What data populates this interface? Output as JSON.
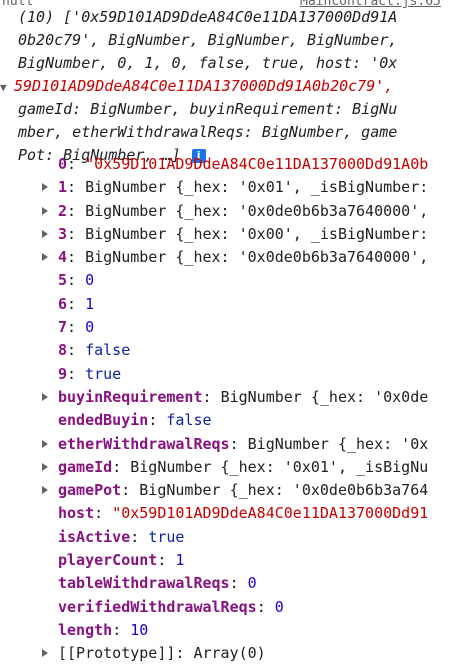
{
  "top_cut": {
    "left_text": "null",
    "right_link": "Maincontract.js:65"
  },
  "summary": {
    "line1": "(10) ['0x59D101AD9DdeA84C0e11DA137000Dd91A",
    "line2": "0b20c79', BigNumber, BigNumber, BigNumber, ",
    "line3": "BigNumber, 0, 1, 0, false, true, host: '0x",
    "line4": "59D101AD9DdeA84C0e11DA137000Dd91A0b20c79',",
    "line5": "gameId: BigNumber, buyinRequirement: BigNu",
    "line6": "mber, etherWithdrawalReqs: BigNumber, game",
    "line7": "Pot: BigNumber, …]",
    "info_icon": "i"
  },
  "entries": [
    {
      "key": "0",
      "type": "str",
      "value": "\"0x59D101AD9DdeA84C0e11DA137000Dd91A0b",
      "expandable": false
    },
    {
      "key": "1",
      "type": "obj",
      "value": "BigNumber {_hex: '0x01', _isBigNumber:",
      "expandable": true
    },
    {
      "key": "2",
      "type": "obj",
      "value": "BigNumber {_hex: '0x0de0b6b3a7640000',",
      "expandable": true
    },
    {
      "key": "3",
      "type": "obj",
      "value": "BigNumber {_hex: '0x00', _isBigNumber:",
      "expandable": true
    },
    {
      "key": "4",
      "type": "obj",
      "value": "BigNumber {_hex: '0x0de0b6b3a7640000',",
      "expandable": true
    },
    {
      "key": "5",
      "type": "num",
      "value": "0",
      "expandable": false
    },
    {
      "key": "6",
      "type": "num",
      "value": "1",
      "expandable": false
    },
    {
      "key": "7",
      "type": "num",
      "value": "0",
      "expandable": false
    },
    {
      "key": "8",
      "type": "kw",
      "value": "false",
      "expandable": false
    },
    {
      "key": "9",
      "type": "kw",
      "value": "true",
      "expandable": false
    },
    {
      "key": "buyinRequirement",
      "type": "obj",
      "value": "BigNumber {_hex: '0x0de",
      "expandable": true
    },
    {
      "key": "endedBuyin",
      "type": "kw",
      "value": "false",
      "expandable": false
    },
    {
      "key": "etherWithdrawalReqs",
      "type": "obj",
      "value": "BigNumber {_hex: '0x",
      "expandable": true
    },
    {
      "key": "gameId",
      "type": "obj",
      "value": "BigNumber {_hex: '0x01', _isBigNu",
      "expandable": true
    },
    {
      "key": "gamePot",
      "type": "obj",
      "value": "BigNumber {_hex: '0x0de0b6b3a764",
      "expandable": true
    },
    {
      "key": "host",
      "type": "str",
      "value": "\"0x59D101AD9DdeA84C0e11DA137000Dd91",
      "expandable": false
    },
    {
      "key": "isActive",
      "type": "kw",
      "value": "true",
      "expandable": false
    },
    {
      "key": "playerCount",
      "type": "num",
      "value": "1",
      "expandable": false
    },
    {
      "key": "tableWithdrawalReqs",
      "type": "num",
      "value": "0",
      "expandable": false
    },
    {
      "key": "verifiedWithdrawalReqs",
      "type": "num",
      "value": "0",
      "expandable": false
    },
    {
      "key": "length",
      "type": "num",
      "value": "10",
      "expandable": false
    },
    {
      "key": "[[Prototype]]",
      "type": "obj",
      "value": "Array(0)",
      "expandable": true
    }
  ]
}
